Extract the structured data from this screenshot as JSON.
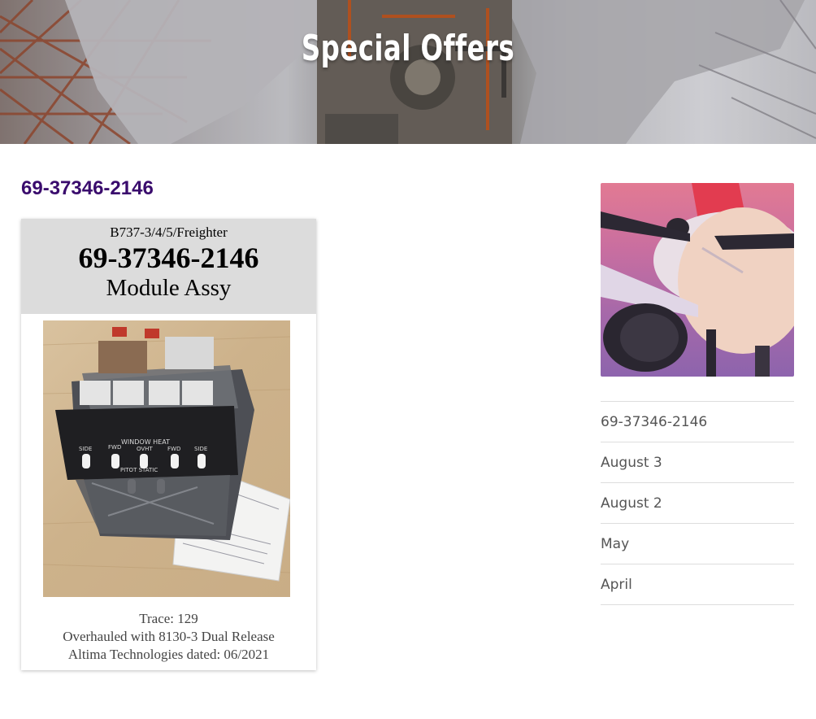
{
  "hero": {
    "title": "Special Offers"
  },
  "post": {
    "title": "69-37346-2146",
    "card": {
      "applicability": "B737-3/4/5/Freighter",
      "part_number": "69-37346-2146",
      "part_name": "Module Assy",
      "photo_panel": {
        "top_label": "WINDOW HEAT",
        "switch_labels": [
          "SIDE",
          "FWD",
          "OVHT",
          "FWD",
          "SIDE"
        ],
        "bottom_label": "PITOT STATIC"
      },
      "notes": [
        "Trace: 129",
        "Overhauled with 8130-3 Dual Release",
        "Altima Technologies dated: 06/2021"
      ]
    }
  },
  "sidebar": {
    "links": [
      "69-37346-2146",
      "August 3",
      "August 2",
      "May",
      "April"
    ]
  },
  "colors": {
    "title_purple": "#3a0c6d",
    "card_header_gray": "#dcdcdc"
  }
}
